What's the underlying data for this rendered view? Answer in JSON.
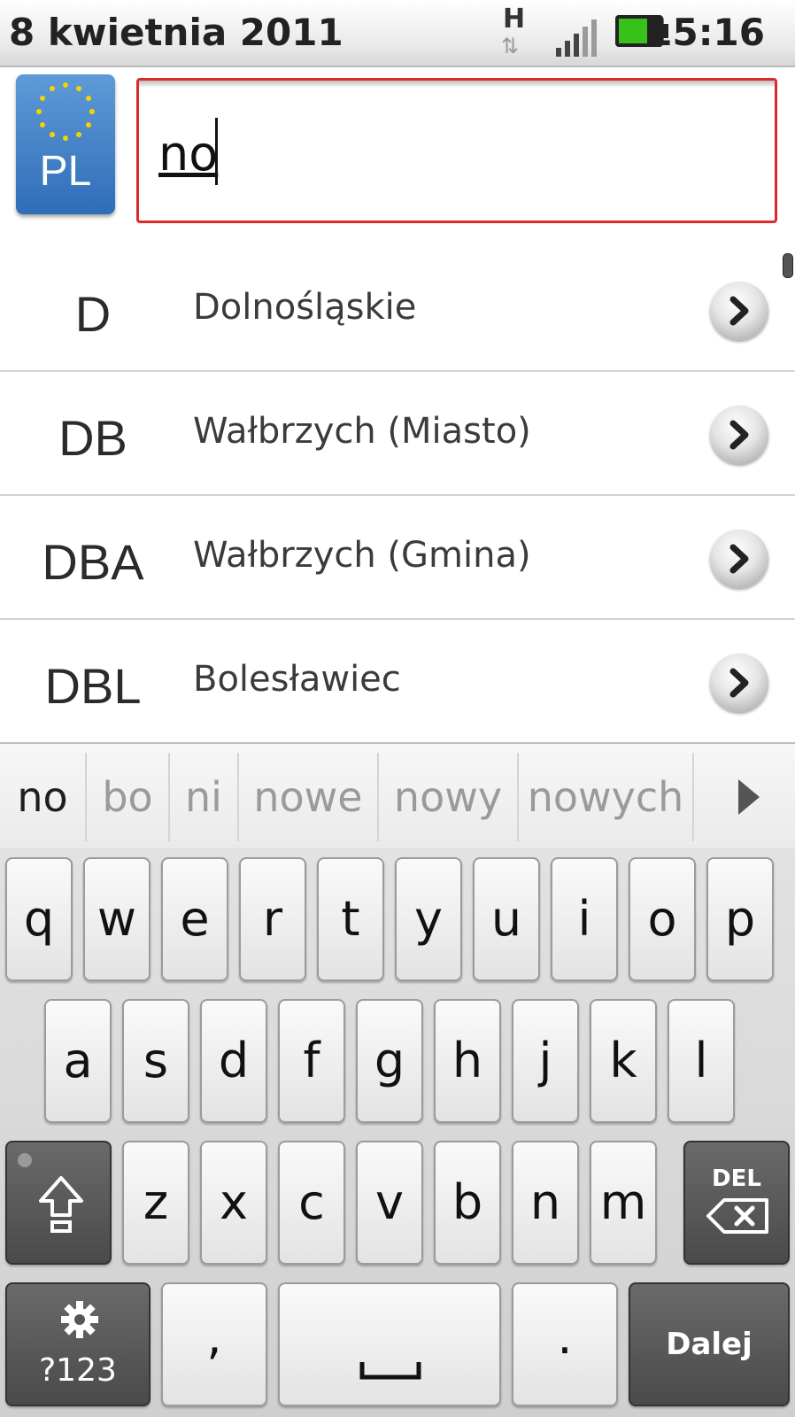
{
  "status_bar": {
    "date": "8 kwietnia 2011",
    "time": "15:16",
    "network": "H",
    "battery_color": "#36c21a"
  },
  "header": {
    "plate_code": "PL",
    "search_value": "no",
    "input_border_color": "#d92b2b"
  },
  "list": [
    {
      "code": "D",
      "name": "Dolnośląskie"
    },
    {
      "code": "DB",
      "name": "Wałbrzych (Miasto)"
    },
    {
      "code": "DBA",
      "name": "Wałbrzych (Gmina)"
    },
    {
      "code": "DBL",
      "name": "Bolesławiec"
    }
  ],
  "suggestions": [
    "no",
    "bo",
    "ni",
    "nowe",
    "nowy",
    "nowych"
  ],
  "keyboard": {
    "row1": [
      "q",
      "w",
      "e",
      "r",
      "t",
      "y",
      "u",
      "i",
      "o",
      "p"
    ],
    "row2": [
      "a",
      "s",
      "d",
      "f",
      "g",
      "h",
      "j",
      "k",
      "l"
    ],
    "row3": [
      "z",
      "x",
      "c",
      "v",
      "b",
      "n",
      "m"
    ],
    "del_label": "DEL",
    "symbols_label": "?123",
    "comma": ",",
    "period": ".",
    "enter_label": "Dalej"
  }
}
